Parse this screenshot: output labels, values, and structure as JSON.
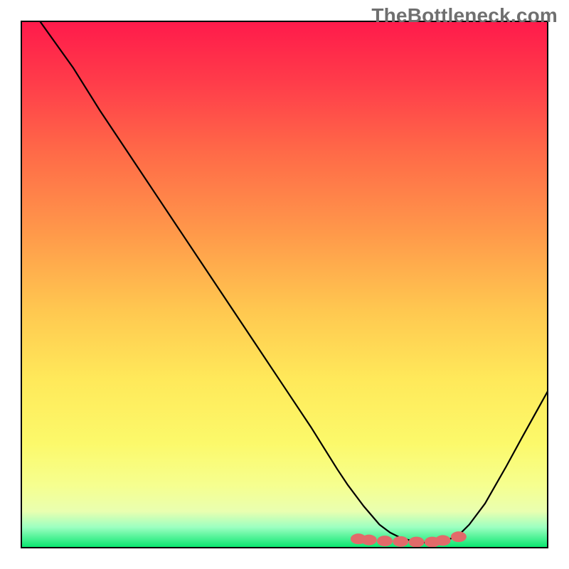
{
  "watermark": "TheBottleneck.com",
  "colors": {
    "curve": "#000000",
    "marker_fill": "#e26a6a",
    "marker_stroke": "#c94f4f"
  },
  "chart_data": {
    "type": "line",
    "title": "",
    "xlabel": "",
    "ylabel": "",
    "xlim": [
      0,
      100
    ],
    "ylim": [
      0,
      100
    ],
    "x": [
      0,
      5,
      10,
      15,
      20,
      25,
      30,
      35,
      40,
      45,
      50,
      55,
      60,
      62,
      65,
      68,
      70,
      72,
      75,
      78,
      80,
      83,
      85,
      88,
      90,
      92,
      95,
      100
    ],
    "y": [
      105,
      98,
      91,
      83,
      75.5,
      68,
      60.5,
      53,
      45.5,
      38,
      30.5,
      23,
      15,
      12,
      8,
      4.5,
      3,
      2,
      1.2,
      1,
      1.2,
      2.5,
      4.5,
      8.5,
      12,
      15.5,
      21,
      30
    ],
    "markers": {
      "x": [
        64,
        66,
        69,
        72,
        75,
        78,
        80,
        83
      ],
      "y": [
        1.8,
        1.6,
        1.4,
        1.3,
        1.2,
        1.2,
        1.5,
        2.2
      ]
    }
  }
}
